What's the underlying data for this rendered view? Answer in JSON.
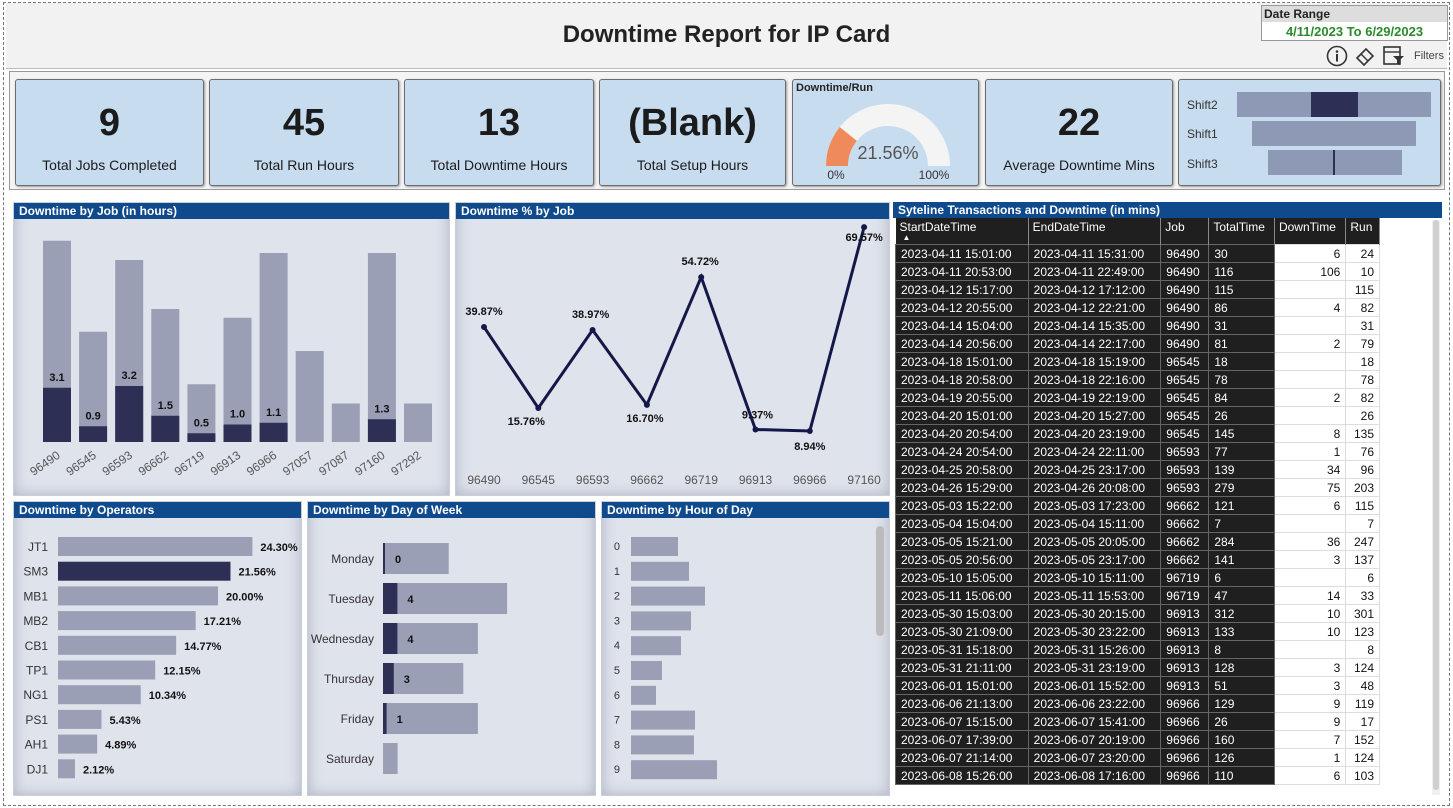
{
  "header": {
    "title": "Downtime Report for IP Card",
    "date_range_label": "Date Range",
    "date_range_value": "4/11/2023 To 6/29/2023",
    "filters_label": "Filters",
    "icons": [
      "info-icon",
      "eraser-icon",
      "filter-pane-icon"
    ]
  },
  "kpis": [
    {
      "value": "9",
      "label": "Total Jobs Completed"
    },
    {
      "value": "45",
      "label": "Total Run Hours"
    },
    {
      "value": "13",
      "label": "Total Downtime Hours"
    },
    {
      "value": "(Blank)",
      "label": "Total Setup Hours"
    },
    {
      "value": "22",
      "label": "Average Downtime Mins"
    }
  ],
  "gauge": {
    "title": "Downtime/Run",
    "value_label": "21.56%",
    "value": 0.2156,
    "min_label": "0%",
    "max_label": "100%",
    "fill_color": "#ef8b5a",
    "track_color": "#f4f4f4"
  },
  "shifts": {
    "labels": [
      "Shift2",
      "Shift1",
      "Shift3"
    ],
    "colors": {
      "bar": "#8e9ab5",
      "highlight": "#2d3054"
    }
  },
  "panels": {
    "job_hours": "Downtime by Job (in hours)",
    "job_pct": "Downtime % by Job",
    "table": "Syteline Transactions and Downtime (in mins)",
    "operators": "Downtime by Operators",
    "day_of_week": "Downtime by Day of Week",
    "hour_of_day": "Downtime by Hour of Day"
  },
  "chart_data": [
    {
      "type": "bar",
      "title": "Downtime by Job (in hours)",
      "categories": [
        "96490",
        "96545",
        "96593",
        "96662",
        "96719",
        "96913",
        "96966",
        "97057",
        "97087",
        "97160",
        "97292"
      ],
      "series": [
        {
          "name": "Run",
          "values": [
            11.5,
            6.3,
            10.4,
            7.6,
            3.3,
            7.1,
            10.8,
            5.2,
            2.2,
            10.8,
            2.2
          ]
        },
        {
          "name": "Downtime",
          "values": [
            3.1,
            0.9,
            3.2,
            1.5,
            0.5,
            1.0,
            1.1,
            null,
            null,
            1.3,
            null
          ]
        }
      ],
      "data_labels": [
        "3.1",
        "0.9",
        "3.2",
        "1.5",
        "0.5",
        "1.0",
        "1.1",
        "",
        "",
        "1.3",
        ""
      ]
    },
    {
      "type": "line",
      "title": "Downtime % by Job",
      "categories": [
        "96490",
        "96545",
        "96593",
        "96662",
        "96719",
        "96913",
        "96966",
        "97160"
      ],
      "values": [
        39.87,
        15.76,
        38.97,
        16.7,
        54.72,
        9.37,
        8.94,
        69.57
      ],
      "data_labels": [
        "39.87%",
        "15.76%",
        "38.97%",
        "16.70%",
        "54.72%",
        "9.37%",
        "8.94%",
        "69.57%"
      ],
      "ylim": [
        0,
        72
      ]
    },
    {
      "type": "bar",
      "orientation": "horizontal",
      "title": "Downtime by Operators",
      "categories": [
        "JT1",
        "SM3",
        "MB1",
        "MB2",
        "CB1",
        "TP1",
        "NG1",
        "PS1",
        "AH1",
        "DJ1"
      ],
      "values": [
        24.3,
        21.56,
        20.0,
        17.21,
        14.77,
        12.15,
        10.34,
        5.43,
        4.89,
        2.12
      ],
      "data_labels": [
        "24.30%",
        "21.56%",
        "20.00%",
        "17.21%",
        "14.77%",
        "12.15%",
        "10.34%",
        "5.43%",
        "4.89%",
        "2.12%"
      ],
      "highlight": "SM3"
    },
    {
      "type": "bar",
      "orientation": "horizontal",
      "title": "Downtime by Day of Week",
      "categories": [
        "Monday",
        "Tuesday",
        "Wednesday",
        "Thursday",
        "Friday",
        "Saturday"
      ],
      "series": [
        {
          "name": "Run",
          "values": [
            9,
            17,
            13,
            11,
            13,
            2
          ]
        },
        {
          "name": "Downtime",
          "values": [
            0,
            4,
            4,
            3,
            1,
            null
          ]
        }
      ],
      "data_labels": [
        "0",
        "4",
        "4",
        "3",
        "1",
        ""
      ]
    },
    {
      "type": "bar",
      "orientation": "horizontal",
      "title": "Downtime by Hour of Day",
      "categories": [
        "0",
        "1",
        "2",
        "3",
        "4",
        "5",
        "6",
        "7",
        "8",
        "9"
      ],
      "values": [
        47,
        58,
        74,
        60,
        50,
        31,
        25,
        64,
        63,
        86
      ]
    }
  ],
  "table": {
    "columns": [
      "StartDateTime",
      "EndDateTime",
      "Job",
      "TotalTime",
      "DownTime",
      "Run"
    ],
    "rows": [
      [
        "2023-04-11 15:01:00",
        "2023-04-11 15:31:00",
        "96490",
        "30",
        "6",
        "24"
      ],
      [
        "2023-04-11 20:53:00",
        "2023-04-11 22:49:00",
        "96490",
        "116",
        "106",
        "10"
      ],
      [
        "2023-04-12 15:17:00",
        "2023-04-12 17:12:00",
        "96490",
        "115",
        "",
        "115"
      ],
      [
        "2023-04-12 20:55:00",
        "2023-04-12 22:21:00",
        "96490",
        "86",
        "4",
        "82"
      ],
      [
        "2023-04-14 15:04:00",
        "2023-04-14 15:35:00",
        "96490",
        "31",
        "",
        "31"
      ],
      [
        "2023-04-14 20:56:00",
        "2023-04-14 22:17:00",
        "96490",
        "81",
        "2",
        "79"
      ],
      [
        "2023-04-18 15:01:00",
        "2023-04-18 15:19:00",
        "96545",
        "18",
        "",
        "18"
      ],
      [
        "2023-04-18 20:58:00",
        "2023-04-18 22:16:00",
        "96545",
        "78",
        "",
        "78"
      ],
      [
        "2023-04-19 20:55:00",
        "2023-04-19 22:19:00",
        "96545",
        "84",
        "2",
        "82"
      ],
      [
        "2023-04-20 15:01:00",
        "2023-04-20 15:27:00",
        "96545",
        "26",
        "",
        "26"
      ],
      [
        "2023-04-20 20:54:00",
        "2023-04-20 23:19:00",
        "96545",
        "145",
        "8",
        "135"
      ],
      [
        "2023-04-24 20:54:00",
        "2023-04-24 22:11:00",
        "96593",
        "77",
        "1",
        "76"
      ],
      [
        "2023-04-25 20:58:00",
        "2023-04-25 23:17:00",
        "96593",
        "139",
        "34",
        "96"
      ],
      [
        "2023-04-26 15:29:00",
        "2023-04-26 20:08:00",
        "96593",
        "279",
        "75",
        "203"
      ],
      [
        "2023-05-03 15:22:00",
        "2023-05-03 17:23:00",
        "96662",
        "121",
        "6",
        "115"
      ],
      [
        "2023-05-04 15:04:00",
        "2023-05-04 15:11:00",
        "96662",
        "7",
        "",
        "7"
      ],
      [
        "2023-05-05 15:21:00",
        "2023-05-05 20:05:00",
        "96662",
        "284",
        "36",
        "247"
      ],
      [
        "2023-05-05 20:56:00",
        "2023-05-05 23:17:00",
        "96662",
        "141",
        "3",
        "137"
      ],
      [
        "2023-05-10 15:05:00",
        "2023-05-10 15:11:00",
        "96719",
        "6",
        "",
        "6"
      ],
      [
        "2023-05-11 15:06:00",
        "2023-05-11 15:53:00",
        "96719",
        "47",
        "14",
        "33"
      ],
      [
        "2023-05-30 15:03:00",
        "2023-05-30 20:15:00",
        "96913",
        "312",
        "10",
        "301"
      ],
      [
        "2023-05-30 21:09:00",
        "2023-05-30 23:22:00",
        "96913",
        "133",
        "10",
        "123"
      ],
      [
        "2023-05-31 15:18:00",
        "2023-05-31 15:26:00",
        "96913",
        "8",
        "",
        "8"
      ],
      [
        "2023-05-31 21:11:00",
        "2023-05-31 23:19:00",
        "96913",
        "128",
        "3",
        "124"
      ],
      [
        "2023-06-01 15:01:00",
        "2023-06-01 15:52:00",
        "96913",
        "51",
        "3",
        "48"
      ],
      [
        "2023-06-06 21:13:00",
        "2023-06-06 23:22:00",
        "96966",
        "129",
        "9",
        "119"
      ],
      [
        "2023-06-07 15:15:00",
        "2023-06-07 15:41:00",
        "96966",
        "26",
        "9",
        "17"
      ],
      [
        "2023-06-07 17:39:00",
        "2023-06-07 20:19:00",
        "96966",
        "160",
        "7",
        "152"
      ],
      [
        "2023-06-07 21:14:00",
        "2023-06-07 23:20:00",
        "96966",
        "126",
        "1",
        "124"
      ],
      [
        "2023-06-08 15:26:00",
        "2023-06-08 17:16:00",
        "96966",
        "110",
        "6",
        "103"
      ]
    ]
  },
  "colors": {
    "bar": "#9a9fb6",
    "dark": "#2d3054",
    "header_blue": "#0e4a8c",
    "card": "#c8dcf0"
  }
}
